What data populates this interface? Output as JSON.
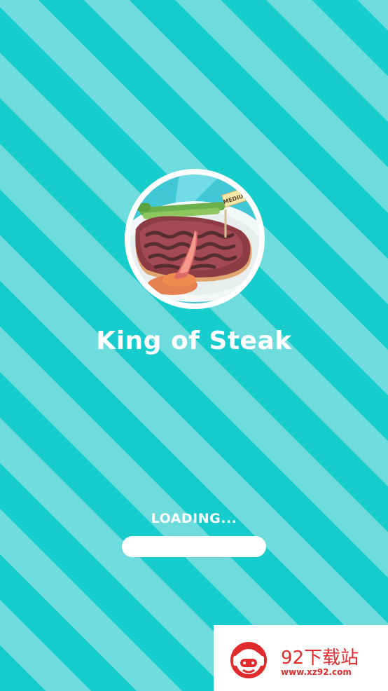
{
  "game": {
    "title": "King of Steak",
    "icon": "steak-plate-icon",
    "flag_text": "MEDIUM"
  },
  "loading": {
    "label": "LOADING...",
    "progress": 0.0
  },
  "watermark": {
    "name": "92下载站",
    "url": "www.xz92.com",
    "logo": "gamepad-mascot-logo"
  },
  "colors": {
    "stripe_dark": "#17cccc",
    "stripe_light": "#6edcdc",
    "text": "#ffffff",
    "watermark_red": "#e02c2c"
  }
}
